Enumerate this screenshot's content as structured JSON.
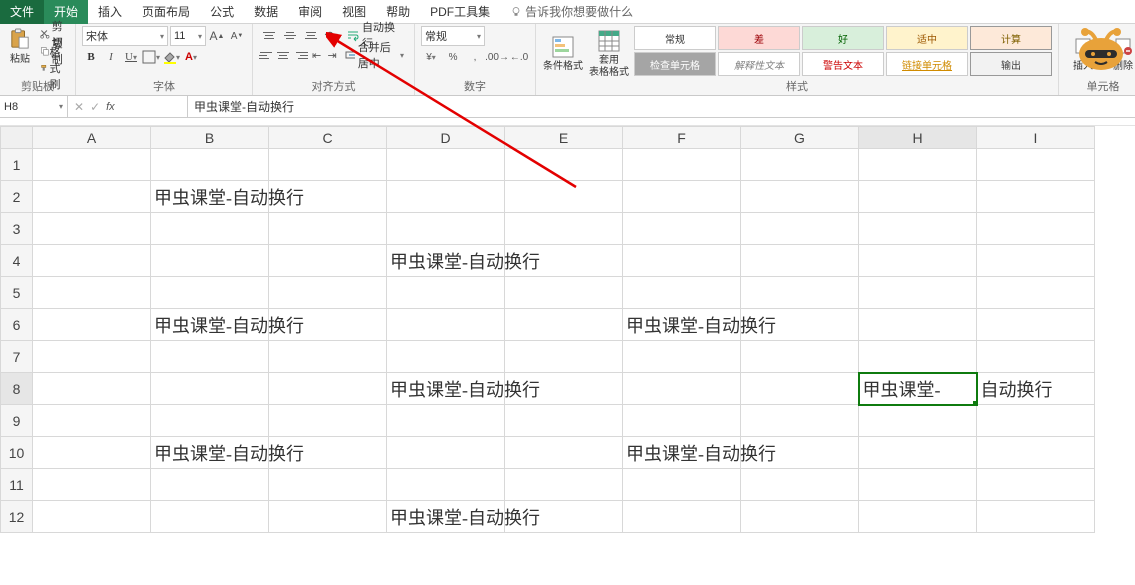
{
  "tabs": {
    "file": "文件",
    "home": "开始",
    "insert": "插入",
    "page_layout": "页面布局",
    "formulas": "公式",
    "data": "数据",
    "review": "审阅",
    "view": "视图",
    "help": "帮助",
    "pdf": "PDF工具集",
    "tell_me": "告诉我你想要做什么"
  },
  "ribbon": {
    "clipboard": {
      "paste": "粘贴",
      "cut": "剪切",
      "copy": "复制",
      "format_painter": "格式刷",
      "label": "剪贴板"
    },
    "font": {
      "name": "宋体",
      "size": "11",
      "label": "字体"
    },
    "alignment": {
      "wrap": "自动换行",
      "merge": "合并后居中",
      "label": "对齐方式"
    },
    "number": {
      "format": "常规",
      "label": "数字"
    },
    "cond_fmt": "条件格式",
    "table_fmt": "套用\n表格格式",
    "styles": {
      "normal": "常规",
      "bad": "差",
      "good": "好",
      "neutral": "适中",
      "calc": "计算",
      "check": "检查单元格",
      "explain": "解释性文本",
      "warn": "警告文本",
      "link": "链接单元格",
      "output": "输出",
      "label": "样式"
    },
    "cells": {
      "insert": "插入",
      "delete": "删除",
      "label": "单元格"
    }
  },
  "name_box": "H8",
  "formula_value": "甲虫课堂-自动换行",
  "columns": [
    "A",
    "B",
    "C",
    "D",
    "E",
    "F",
    "G",
    "H",
    "I"
  ],
  "rows": [
    1,
    2,
    3,
    4,
    5,
    6,
    7,
    8,
    9,
    10,
    11,
    12
  ],
  "cell_text": "甲虫课堂-自动换行",
  "sel_left": "甲虫课堂-",
  "sel_right": "自动换行",
  "cells": {
    "B2": "甲虫课堂-自动换行",
    "D4": "甲虫课堂-自动换行",
    "B6": "甲虫课堂-自动换行",
    "F6": "甲虫课堂-自动换行",
    "D8": "甲虫课堂-自动换行",
    "H8": "甲虫课堂-自动换行",
    "B10": "甲虫课堂-自动换行",
    "F10": "甲虫课堂-自动换行",
    "D12": "甲虫课堂-自动换行"
  },
  "selected_cell": "H8"
}
